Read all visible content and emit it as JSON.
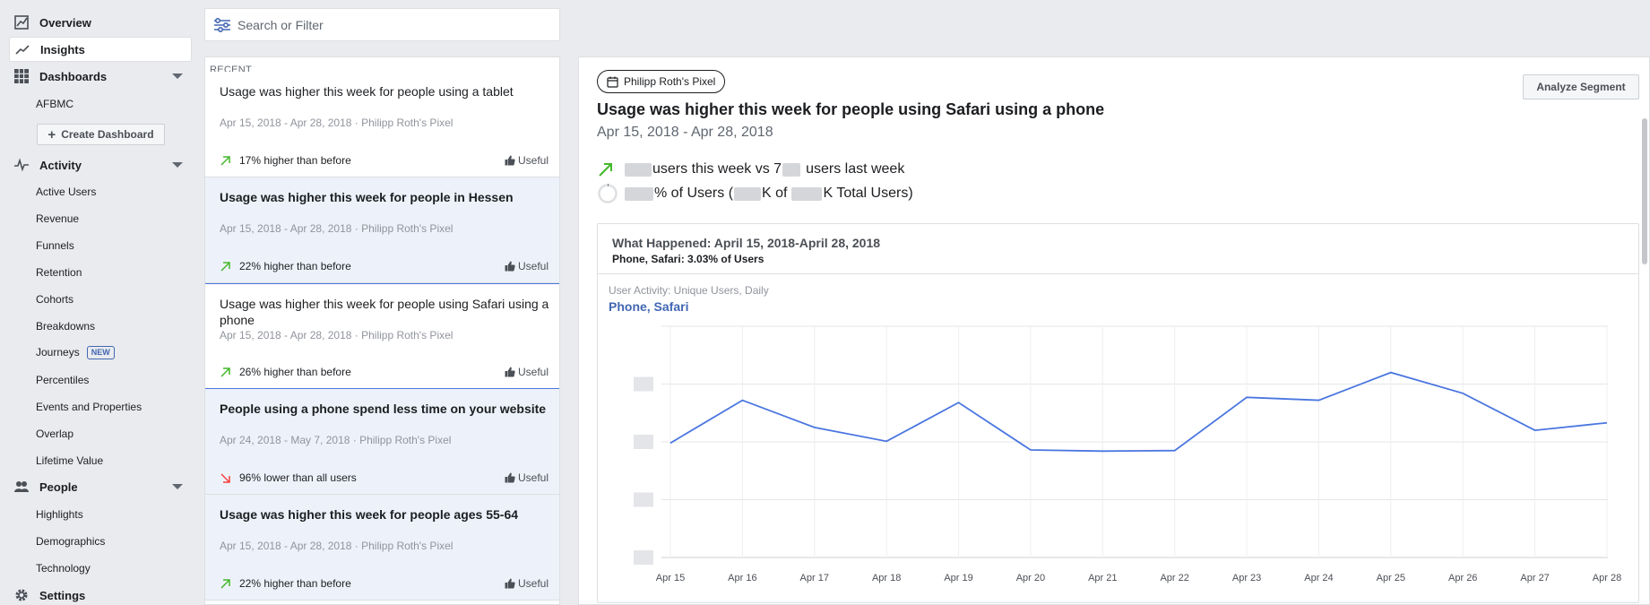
{
  "sidebar": {
    "overview": "Overview",
    "insights": "Insights",
    "dashboards": "Dashboards",
    "afbmc": "AFBMC",
    "create_dashboard": "Create Dashboard",
    "activity": "Activity",
    "activity_items": [
      "Active Users",
      "Revenue",
      "Funnels",
      "Retention",
      "Cohorts",
      "Breakdowns",
      "Journeys",
      "Percentiles",
      "Events and Properties",
      "Overlap",
      "Lifetime Value"
    ],
    "new_badge": "NEW",
    "people": "People",
    "people_items": [
      "Highlights",
      "Demographics",
      "Technology"
    ],
    "settings": "Settings"
  },
  "search": {
    "placeholder": "Search or Filter"
  },
  "list": {
    "header": "RECENT",
    "useful_label": "Useful",
    "cards": [
      {
        "title": "Usage was higher this week for people using a tablet",
        "meta": "Apr 15, 2018 - Apr 28, 2018 · Philipp Roth's Pixel",
        "stat": "17% higher than before",
        "trend": "up",
        "state": "read"
      },
      {
        "title": "Usage was higher this week for people in Hessen",
        "meta": "Apr 15, 2018 - Apr 28, 2018 · Philipp Roth's Pixel",
        "stat": "22% higher than before",
        "trend": "up",
        "state": "unread"
      },
      {
        "title": "Usage was higher this week for people using Safari using a phone",
        "meta": "Apr 15, 2018 - Apr 28, 2018 · Philipp Roth's Pixel",
        "stat": "26% higher than before",
        "trend": "up",
        "state": "selected"
      },
      {
        "title": "People using a phone spend less time on your website",
        "meta": "Apr 24, 2018 - May 7, 2018 · Philipp Roth's Pixel",
        "stat": "96% lower than all users",
        "trend": "down",
        "state": "unread"
      },
      {
        "title": "Usage was higher this week for people ages 55-64",
        "meta": "Apr 15, 2018 - Apr 28, 2018 · Philipp Roth's Pixel",
        "stat": "22% higher than before",
        "trend": "up",
        "state": "unread"
      }
    ]
  },
  "detail": {
    "pixel": "Philipp Roth's Pixel",
    "analyze": "Analyze Segment",
    "title": "Usage was higher this week for people using Safari using a phone",
    "date": "Apr 15, 2018 - Apr 28, 2018",
    "line1_a": "users this week vs 7",
    "line1_b": "users last week",
    "line2_a": "% of Users (",
    "line2_b": "K of",
    "line2_c": "K Total Users)",
    "chart_title": "What Happened: April 15, 2018-April 28, 2018",
    "chart_subtitle": "Phone, Safari: 3.03% of Users",
    "chart_label": "User Activity: Unique Users, Daily",
    "series_name": "Phone, Safari"
  },
  "colors": {
    "accent": "#4267b2",
    "line": "#4a76e0",
    "up": "#42b72a",
    "down": "#fa3e3e"
  },
  "chart_data": {
    "type": "line",
    "x": [
      "Apr 15",
      "Apr 16",
      "Apr 17",
      "Apr 18",
      "Apr 19",
      "Apr 20",
      "Apr 21",
      "Apr 22",
      "Apr 23",
      "Apr 24",
      "Apr 25",
      "Apr 26",
      "Apr 27",
      "Apr 28"
    ],
    "series": [
      {
        "name": "Phone, Safari",
        "values": [
          0.98,
          1.72,
          1.25,
          1.01,
          1.68,
          0.86,
          0.84,
          0.85,
          1.77,
          1.72,
          2.2,
          1.84,
          1.2,
          1.33
        ]
      }
    ],
    "ylim": [
      -1,
      3
    ],
    "y_ticks_hidden": true,
    "grid": true
  }
}
